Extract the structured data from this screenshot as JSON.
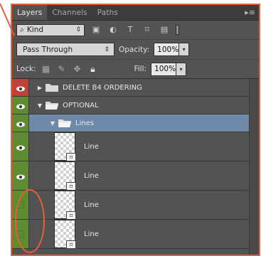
{
  "panel": {
    "tabs": [
      {
        "label": "Layers",
        "active": true
      },
      {
        "label": "Channels",
        "active": false
      },
      {
        "label": "Paths",
        "active": false
      }
    ],
    "menu_icon": "panel-menu-icon"
  },
  "filter": {
    "kind_label": "Kind",
    "icons": [
      "pixel-filter-icon",
      "adjustment-filter-icon",
      "type-filter-icon",
      "shape-filter-icon",
      "smart-object-filter-icon"
    ]
  },
  "blend": {
    "mode": "Pass Through",
    "opacity_label": "Opacity:",
    "opacity_value": "100%"
  },
  "lock": {
    "label": "Lock:",
    "fill_label": "Fill:",
    "fill_value": "100%"
  },
  "layers": [
    {
      "name": "DELETE B4 ORDERING",
      "type": "group",
      "expanded": false,
      "visible": true,
      "eye_bg": "#c0413a"
    },
    {
      "name": "OPTIONAL",
      "type": "group",
      "expanded": true,
      "visible": true,
      "eye_bg": "#5e8d31"
    },
    {
      "name": "Lines",
      "type": "group",
      "expanded": true,
      "visible": true,
      "eye_bg": "#5e8d31",
      "selected": true
    },
    {
      "name": "Line",
      "type": "layer",
      "visible": true,
      "eye_bg": "#5e8d31"
    },
    {
      "name": "Line",
      "type": "layer",
      "visible": true,
      "eye_bg": "#5e8d31"
    },
    {
      "name": "Line",
      "type": "layer",
      "visible": false,
      "eye_bg": "#5e8d31"
    },
    {
      "name": "Line",
      "type": "layer",
      "visible": false,
      "eye_bg": "#5e8d31"
    }
  ],
  "colors": {
    "accent": "#e2613a",
    "panel_bg": "#535353",
    "selection": "#6e8aa8"
  }
}
